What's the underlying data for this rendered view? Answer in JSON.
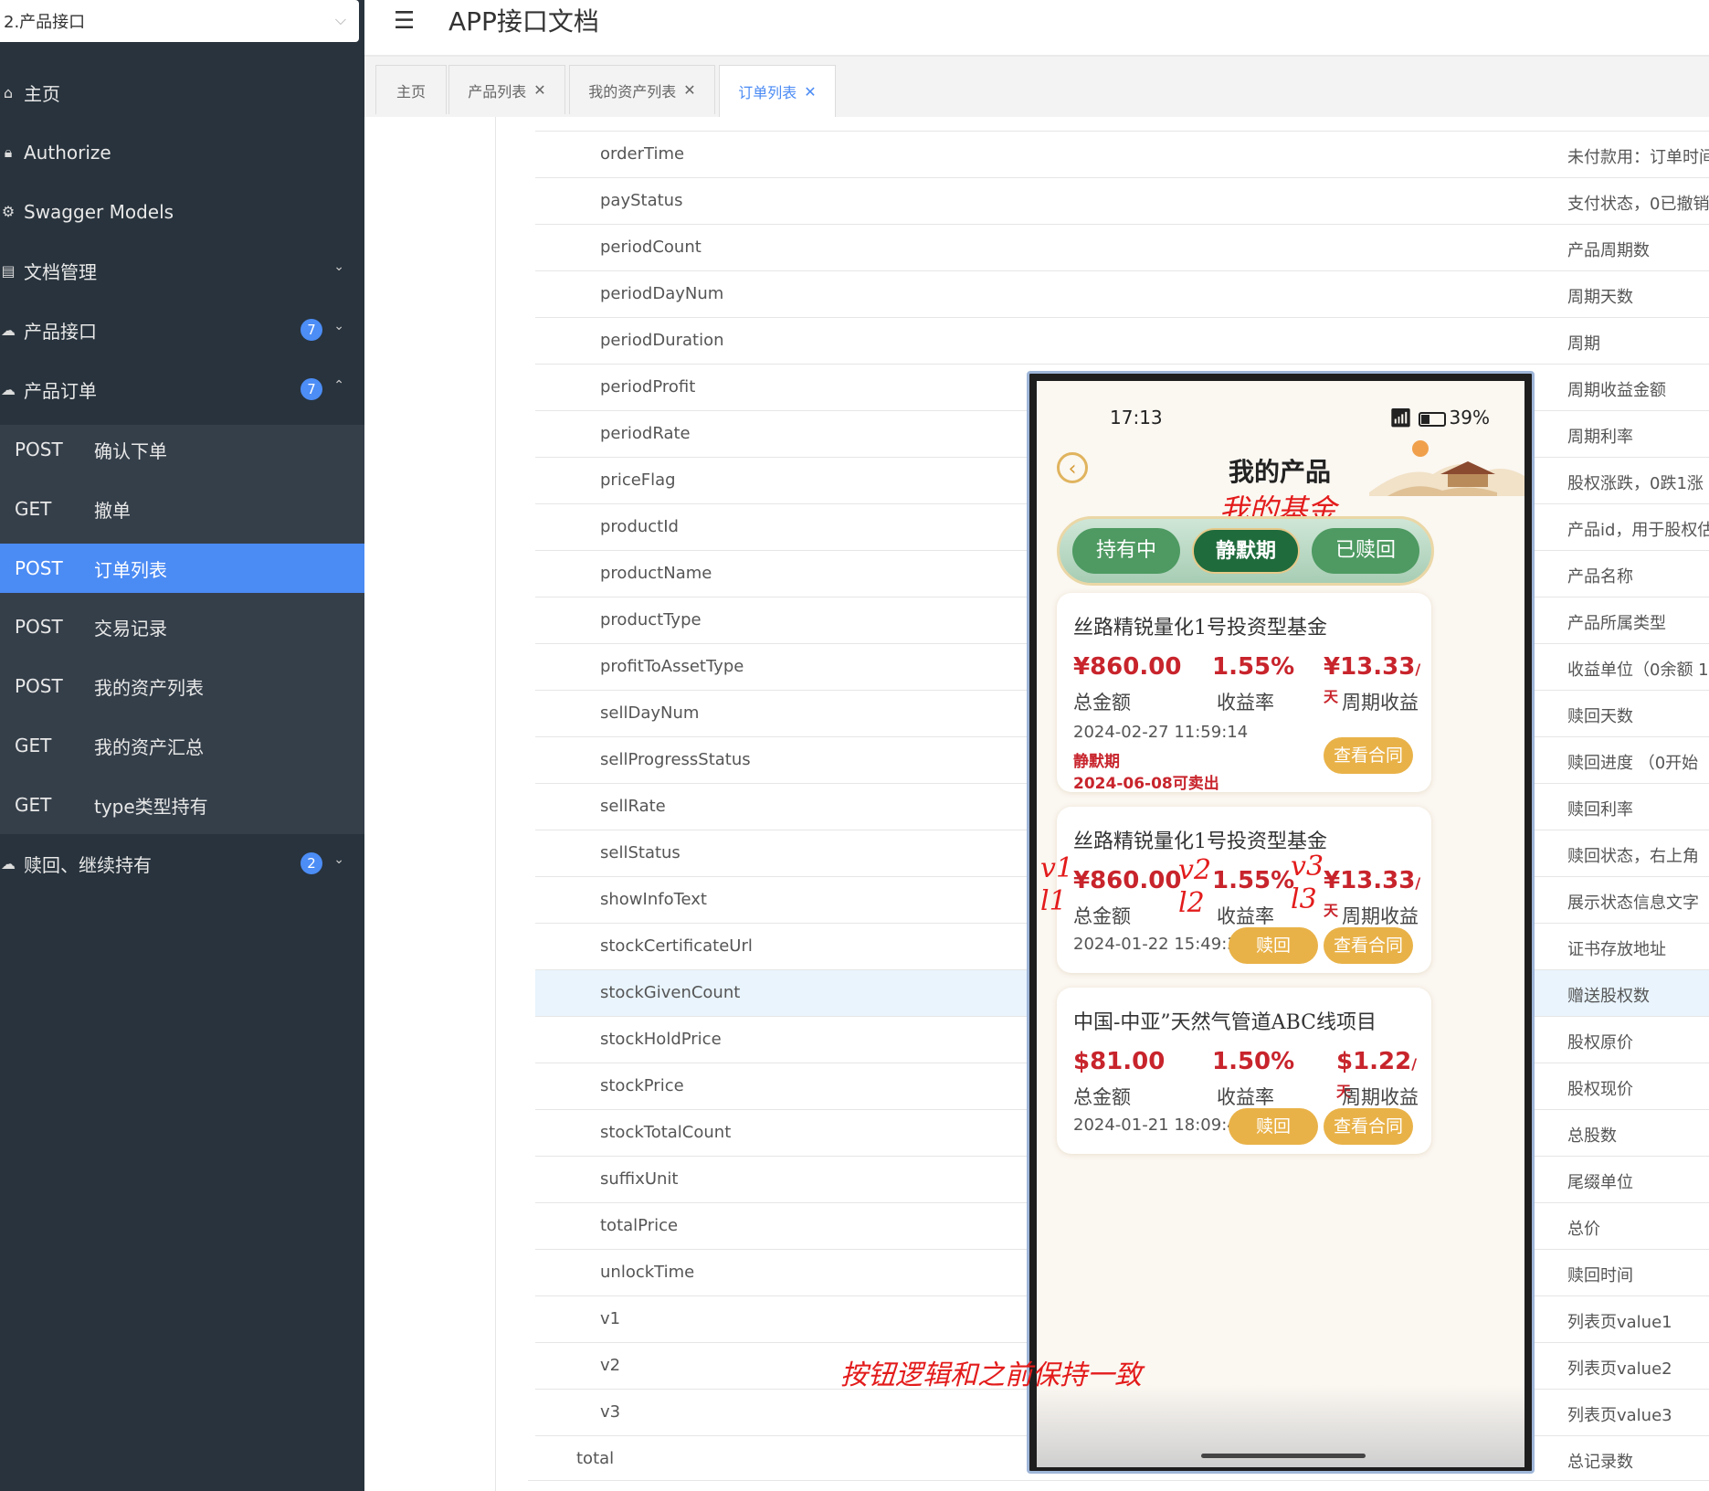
{
  "sidebar": {
    "group_select": "2.产品接口",
    "items": [
      {
        "label": "主页"
      },
      {
        "label": "Authorize"
      },
      {
        "label": "Swagger Models"
      },
      {
        "label": "文档管理"
      },
      {
        "label": "产品接口",
        "badge": "7"
      },
      {
        "label": "产品订单",
        "badge": "7"
      },
      {
        "label": "赎回、继续持有",
        "badge": "2"
      }
    ],
    "apis": [
      {
        "method": "POST",
        "name": "确认下单"
      },
      {
        "method": "GET",
        "name": "撤单"
      },
      {
        "method": "POST",
        "name": "订单列表",
        "active": true
      },
      {
        "method": "POST",
        "name": "交易记录"
      },
      {
        "method": "POST",
        "name": "我的资产列表"
      },
      {
        "method": "GET",
        "name": "我的资产汇总"
      },
      {
        "method": "GET",
        "name": "type类型持有"
      }
    ]
  },
  "header": {
    "title": "APP接口文档"
  },
  "tabs": [
    {
      "label": "主页"
    },
    {
      "label": "产品列表"
    },
    {
      "label": "我的资产列表"
    },
    {
      "label": "订单列表",
      "active": true
    }
  ],
  "fields": [
    {
      "name": "orderTime",
      "desc": "未付款用：订单时间"
    },
    {
      "name": "payStatus",
      "desc": "支付状态，0已撤销"
    },
    {
      "name": "periodCount",
      "desc": "产品周期数"
    },
    {
      "name": "periodDayNum",
      "desc": "周期天数"
    },
    {
      "name": "periodDuration",
      "desc": "周期"
    },
    {
      "name": "periodProfit",
      "desc": "周期收益金额"
    },
    {
      "name": "periodRate",
      "desc": "周期利率"
    },
    {
      "name": "priceFlag",
      "desc": "股权涨跌，0跌1涨"
    },
    {
      "name": "productId",
      "desc": "产品id，用于股权估"
    },
    {
      "name": "productName",
      "desc": "产品名称"
    },
    {
      "name": "productType",
      "desc": "产品所属类型"
    },
    {
      "name": "profitToAssetType",
      "desc": "收益单位（0余额 1"
    },
    {
      "name": "sellDayNum",
      "desc": "赎回天数"
    },
    {
      "name": "sellProgressStatus",
      "desc": "赎回进度 （0开始"
    },
    {
      "name": "sellRate",
      "desc": "赎回利率"
    },
    {
      "name": "sellStatus",
      "desc": "赎回状态，右上角"
    },
    {
      "name": "showInfoText",
      "desc": "展示状态信息文字"
    },
    {
      "name": "stockCertificateUrl",
      "desc": "证书存放地址"
    },
    {
      "name": "stockGivenCount",
      "desc": "赠送股权数",
      "highlight": true
    },
    {
      "name": "stockHoldPrice",
      "desc": "股权原价"
    },
    {
      "name": "stockPrice",
      "desc": "股权现价"
    },
    {
      "name": "stockTotalCount",
      "desc": "总股数"
    },
    {
      "name": "suffixUnit",
      "desc": "尾缀单位"
    },
    {
      "name": "totalPrice",
      "desc": "总价"
    },
    {
      "name": "unlockTime",
      "desc": "赎回时间"
    },
    {
      "name": "v1",
      "desc": "列表页value1"
    },
    {
      "name": "v2",
      "desc": "列表页value2"
    },
    {
      "name": "v3",
      "desc": "列表页value3"
    },
    {
      "name": "total",
      "desc": "总记录数",
      "indent0": true
    }
  ],
  "phone": {
    "time": "17:13",
    "battery": "39%",
    "title": "我的产品",
    "anno_title": "我的基金",
    "segments": [
      "持有中",
      "静默期",
      "已赎回"
    ],
    "cards": [
      {
        "title": "丝路精锐量化1号投资型基金",
        "v1": "¥860.00",
        "v2": "1.55%",
        "v3": "¥13.33",
        "v3_unit": "/天",
        "l1": "总金额",
        "l2": "收益率",
        "l3": "周期收益",
        "date": "2024-02-27 11:59:14",
        "status1": "静默期",
        "status2": "2024-06-08可卖出",
        "btn_contract": "查看合同"
      },
      {
        "title": "丝路精锐量化1号投资型基金",
        "v1": "¥860.00",
        "v2": "1.55%",
        "v3": "¥13.33",
        "v3_unit": "/天",
        "l1": "总金额",
        "l2": "收益率",
        "l3": "周期收益",
        "date": "2024-01-22 15:49:39",
        "btn_redeem": "赎回",
        "btn_contract": "查看合同"
      },
      {
        "title": "中国-中亚”天然气管道ABC线项目",
        "v1": "$81.00",
        "v2": "1.50%",
        "v3": "$1.22",
        "v3_unit": "/天",
        "l1": "总金额",
        "l2": "收益率",
        "l3": "周期收益",
        "date": "2024-01-21 18:09:44",
        "btn_redeem": "赎回",
        "btn_contract": "查看合同"
      }
    ],
    "annotations": {
      "v1": "v1",
      "v2": "v2",
      "v3": "v3",
      "l1": "l1",
      "l2": "l2",
      "l3": "l3",
      "note": "按钮逻辑和之前保持一致"
    }
  }
}
